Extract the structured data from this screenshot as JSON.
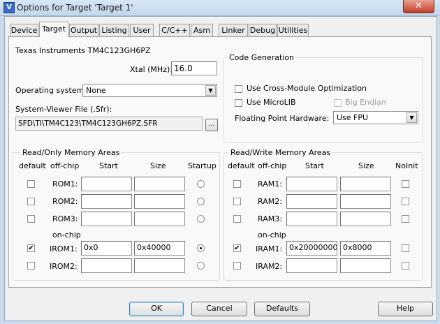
{
  "window": {
    "title": "Options for Target 'Target 1'",
    "icon": "uvision-icon",
    "close_glyph": "✕"
  },
  "tabs": [
    "Device",
    "Target",
    "Output",
    "Listing",
    "User",
    "C/C++",
    "Asm",
    "Linker",
    "Debug",
    "Utilities"
  ],
  "active_tab": "Target",
  "device_name": "Texas Instruments TM4C123GH6PZ",
  "xtal": {
    "label": "Xtal (MHz):",
    "value": "16.0"
  },
  "os": {
    "label": "Operating system:",
    "value": "None"
  },
  "svd": {
    "label": "System-Viewer File (.Sfr):",
    "value": "SFD\\TI\\TM4C123\\TM4C123GH6PZ.SFR",
    "browse_label": "..."
  },
  "code_generation": {
    "title": "Code Generation",
    "cross_module": {
      "label": "Use Cross-Module Optimization",
      "checked": false
    },
    "microlib": {
      "label": "Use MicroLIB",
      "checked": false
    },
    "big_endian": {
      "label": "Big Endian",
      "checked": false,
      "enabled": false
    },
    "fpu": {
      "label": "Floating Point Hardware:",
      "value": "Use FPU"
    }
  },
  "ro_memory": {
    "title": "Read/Only Memory Areas",
    "headers": {
      "default": "default",
      "offchip": "off-chip",
      "start": "Start",
      "size": "Size",
      "startup": "Startup"
    },
    "onchip_label": "on-chip",
    "offchip_rows": [
      {
        "name": "ROM1:",
        "start": "",
        "size": "",
        "default": false,
        "startup": false
      },
      {
        "name": "ROM2:",
        "start": "",
        "size": "",
        "default": false,
        "startup": false
      },
      {
        "name": "ROM3:",
        "start": "",
        "size": "",
        "default": false,
        "startup": false
      }
    ],
    "onchip_rows": [
      {
        "name": "IROM1:",
        "start": "0x0",
        "size": "0x40000",
        "default": true,
        "startup": true
      },
      {
        "name": "IROM2:",
        "start": "",
        "size": "",
        "default": false,
        "startup": false
      }
    ]
  },
  "rw_memory": {
    "title": "Read/Write Memory Areas",
    "headers": {
      "default": "default",
      "offchip": "off-chip",
      "start": "Start",
      "size": "Size",
      "noinit": "NoInit"
    },
    "onchip_label": "on-chip",
    "offchip_rows": [
      {
        "name": "RAM1:",
        "start": "",
        "size": "",
        "default": false,
        "noinit": false
      },
      {
        "name": "RAM2:",
        "start": "",
        "size": "",
        "default": false,
        "noinit": false
      },
      {
        "name": "RAM3:",
        "start": "",
        "size": "",
        "default": false,
        "noinit": false
      }
    ],
    "onchip_rows": [
      {
        "name": "IRAM1:",
        "start": "0x20000000",
        "size": "0x8000",
        "default": true,
        "noinit": false
      },
      {
        "name": "IRAM2:",
        "start": "",
        "size": "",
        "default": false,
        "noinit": false
      }
    ]
  },
  "buttons": {
    "ok": "OK",
    "cancel": "Cancel",
    "defaults": "Defaults",
    "help": "Help"
  },
  "check_glyph": "✔",
  "dropdown_glyph": "▼"
}
